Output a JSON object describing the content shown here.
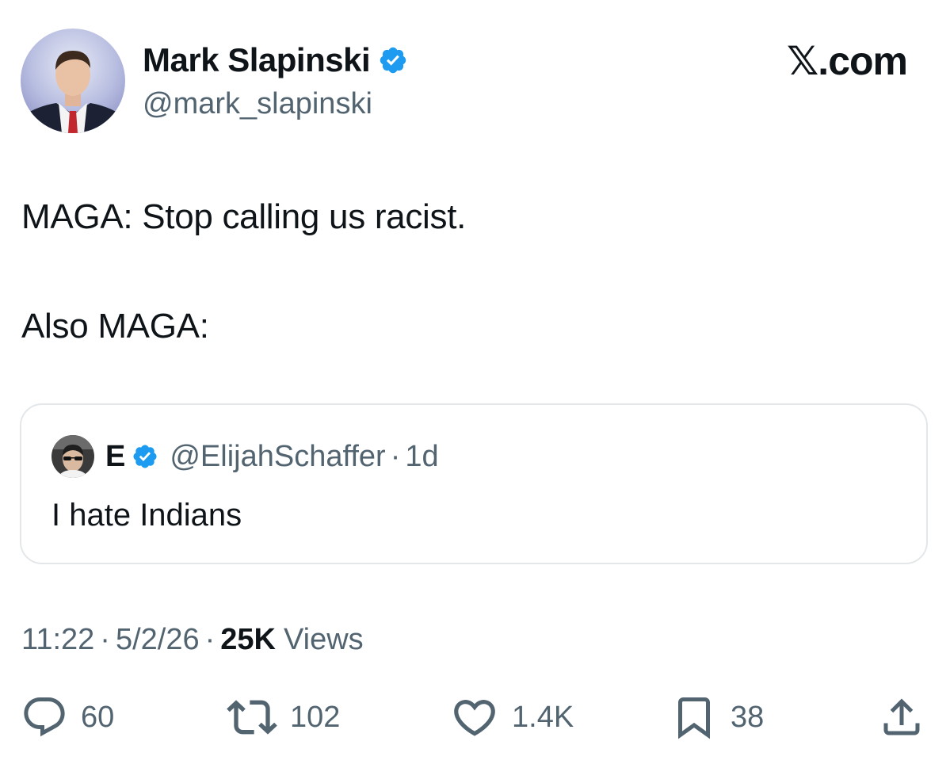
{
  "author": {
    "name": "Mark Slapinski",
    "handle": "@mark_slapinski",
    "verified": true
  },
  "brand": "𝕏.com",
  "tweet": {
    "lines": [
      "MAGA: Stop calling us racist.",
      "Also MAGA:"
    ]
  },
  "quoted_tweet": {
    "name": "E",
    "handle": "@ElijahSchaffer",
    "separator": "·",
    "time": "1d",
    "text": "I hate Indians",
    "verified": true
  },
  "meta": {
    "time": "11:22",
    "separator": "·",
    "date": "5/2/26",
    "views_count": "25K",
    "views_label": "Views"
  },
  "actions": {
    "replies": "60",
    "reposts": "102",
    "likes": "1.4K",
    "bookmarks": "38"
  },
  "colors": {
    "text": "#0f1419",
    "secondary": "#536471",
    "verified": "#1d9bf0",
    "border": "#e3e7ea"
  },
  "icons": [
    "verified-badge-icon",
    "reply-icon",
    "repost-icon",
    "like-icon",
    "bookmark-icon",
    "share-icon"
  ]
}
